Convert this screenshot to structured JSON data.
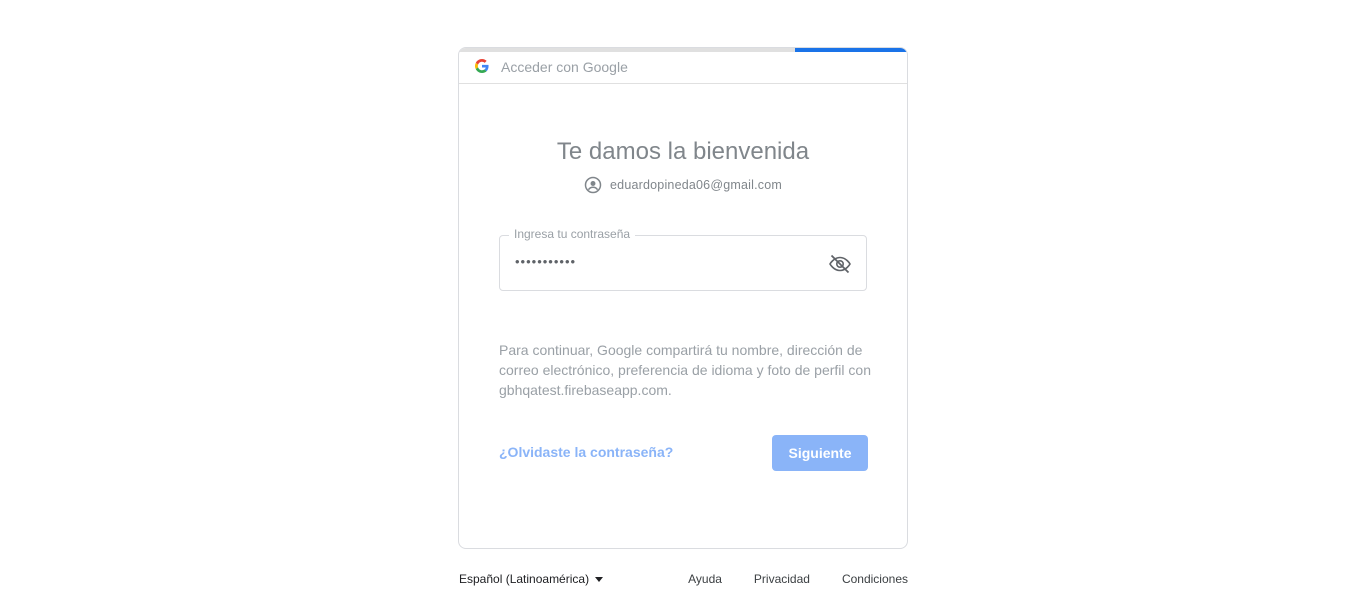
{
  "header": {
    "title": "Acceder con Google",
    "logo_icon": "google-g-icon"
  },
  "progress": {
    "fraction": 0.25,
    "color": "#1a73e8"
  },
  "welcome": {
    "title": "Te damos la bienvenida"
  },
  "account": {
    "email": "eduardopineda06@gmail.com",
    "icon": "account-circle-icon"
  },
  "password": {
    "label": "Ingresa tu contraseña",
    "value": "•••••••••••",
    "toggle_icon": "eye-off-icon"
  },
  "consent": {
    "text": "Para continuar, Google compartirá tu nombre, dirección de correo electrónico, preferencia de idioma y foto de perfil con gbhqatest.firebaseapp.com."
  },
  "actions": {
    "forgot_label": "¿Olvidaste la contraseña?",
    "next_label": "Siguiente"
  },
  "footer": {
    "language": "Español (Latinoamérica)",
    "links": [
      "Ayuda",
      "Privacidad",
      "Condiciones"
    ]
  },
  "colors": {
    "accent": "#1a73e8",
    "disabled_button": "#8ab4f8"
  }
}
